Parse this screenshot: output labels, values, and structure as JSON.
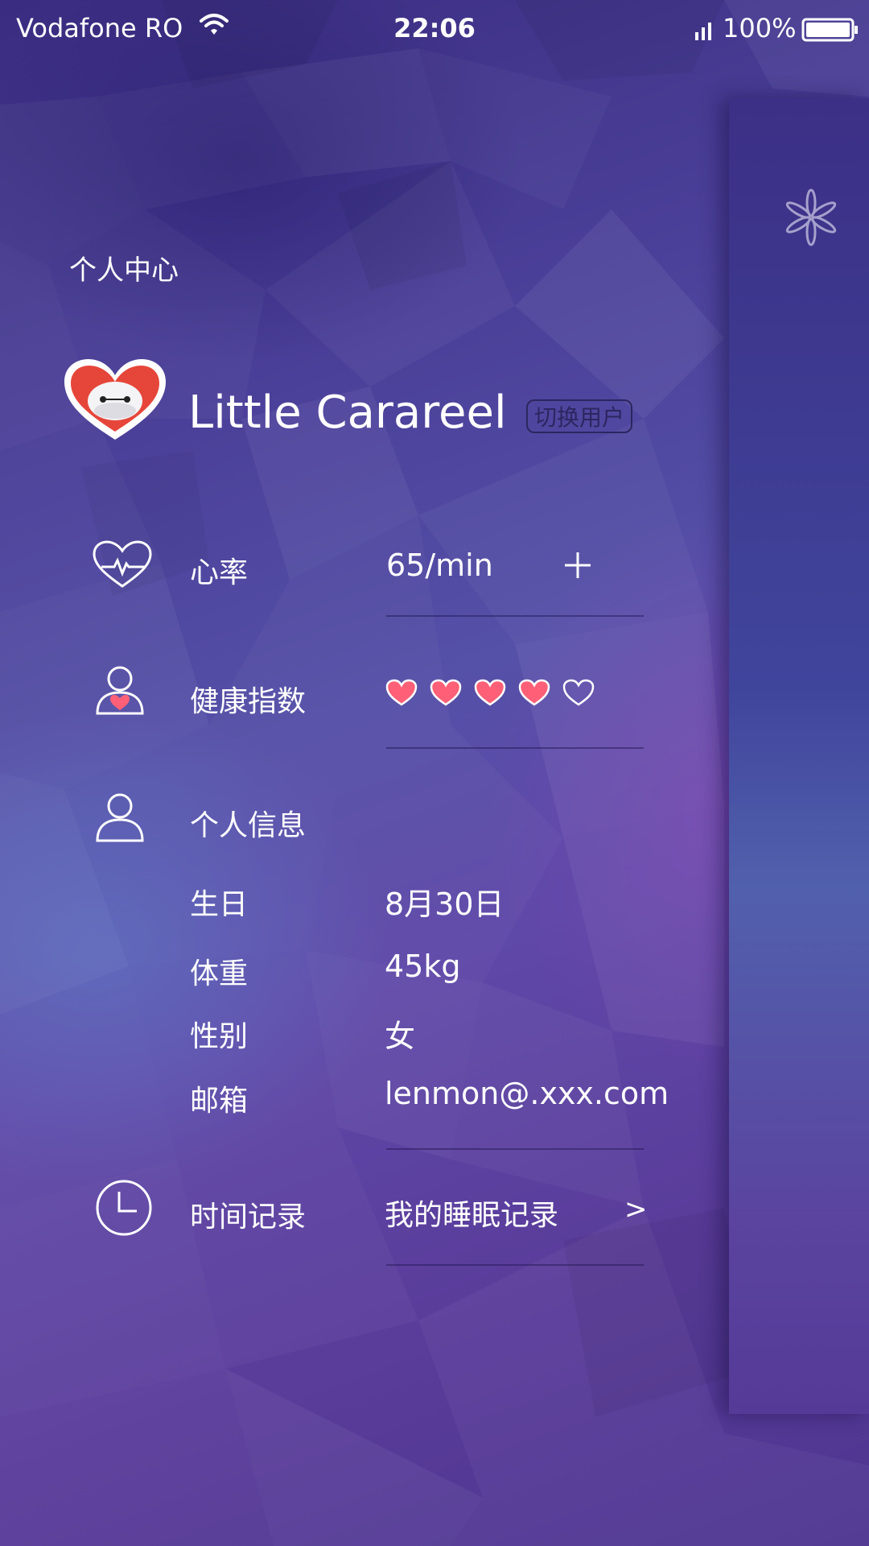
{
  "status_bar": {
    "carrier": "Vodafone RO",
    "time": "22:06",
    "battery": "100%",
    "wifi_icon": "wifi-icon",
    "signal_icon": "signal-icon",
    "battery_icon": "battery-icon"
  },
  "header": {
    "title": "个人中心"
  },
  "profile": {
    "name": "Little Carareel",
    "switch_user_label": "切换用户",
    "avatar_icon": "heart-avatar-icon"
  },
  "heart_rate": {
    "label": "心率",
    "value": "65/min",
    "add_icon": "plus-icon"
  },
  "health_index": {
    "label": "健康指数",
    "rating": 4,
    "max": 5,
    "filled_color": "#ff6077",
    "outline_color": "#ffffff"
  },
  "personal_info": {
    "label": "个人信息",
    "fields": [
      {
        "label": "生日",
        "value": "8月30日"
      },
      {
        "label": "体重",
        "value": "45kg"
      },
      {
        "label": "性别",
        "value": "女"
      },
      {
        "label": "邮箱",
        "value": "lenmon@.xxx.com"
      }
    ]
  },
  "time_record": {
    "label": "时间记录",
    "value": "我的睡眠记录",
    "chevron": ">"
  },
  "side_panel": {
    "icon": "flower-icon"
  },
  "colors": {
    "accent_heart": "#ff6077",
    "avatar_heart": "#e6463a",
    "background_top": "#3a2c80",
    "background_mid": "#5550a8",
    "background_bottom": "#4e3590"
  }
}
